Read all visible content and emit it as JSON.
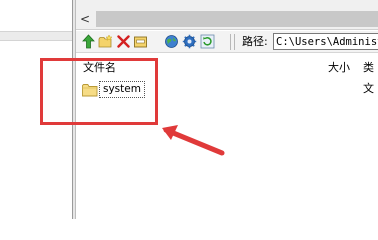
{
  "window": {
    "scroll_left_glyph": "<"
  },
  "toolbar": {
    "icons": [
      "up-arrow-icon",
      "new-folder-icon",
      "delete-icon",
      "rename-icon",
      "globe-icon",
      "settings-gear-icon",
      "refresh-icon"
    ],
    "path_label": "路径:",
    "path_value": "C:\\Users\\Administrator"
  },
  "file_list": {
    "columns": {
      "name": "文件名",
      "size": "大小",
      "type": "类"
    },
    "rows": [
      {
        "icon": "folder-icon",
        "name": "system",
        "size": "",
        "type": "文"
      }
    ]
  },
  "annotation": {
    "highlight_color": "#e03a3a",
    "arrow_color": "#e03a3a"
  }
}
